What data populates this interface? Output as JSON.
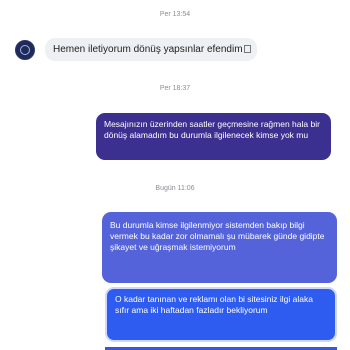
{
  "messages": [
    {
      "timestamp": "Per 13:54",
      "direction": "incoming",
      "text": "Hemen iletiyorum dönüş yapsınlar efendim"
    },
    {
      "timestamp": "Per 18:37",
      "direction": "outgoing",
      "text": "Mesajınızın üzerinden saatler geçmesine rağmen hala bir dönüş alamadım bu durumla ilgilenecek kimse yok mu"
    },
    {
      "timestamp": "Bugün 11:06",
      "direction": "outgoing",
      "text": "Bu durumla kimse ilgilenmiyor sistemden bakıp bilgi vermek bu kadar zor olmamalı şu mübarek günde gidipte şikayet ve uğraşmak istemiyorum"
    },
    {
      "direction": "outgoing",
      "text": "O kadar tanınan ve reklamı olan bi sitesiniz ilgi alaka sıfır ama iki haftadan fazladır bekliyorum"
    }
  ],
  "colors": {
    "incoming_bubble": "#eef0f3",
    "outgoing_bubble_1": "#3b2f8f",
    "outgoing_bubble_2": "#5463d9",
    "outgoing_bubble_3": "#2f5cf0"
  },
  "icons": {
    "avatar": "store-avatar-icon",
    "emoji_placeholder": "missing-glyph-icon"
  }
}
